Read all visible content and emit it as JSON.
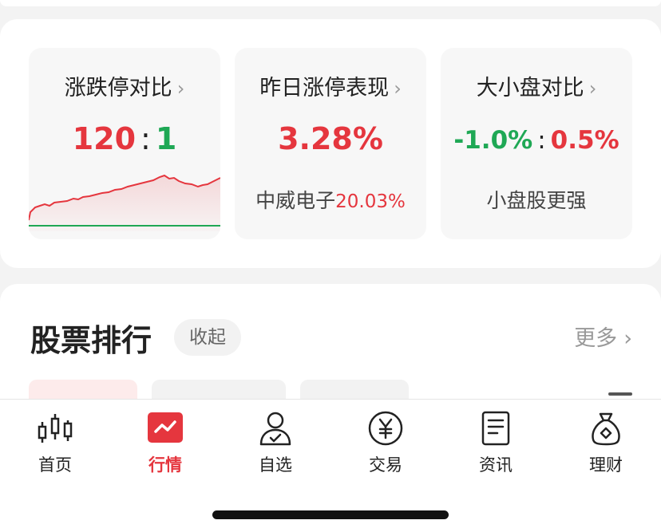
{
  "cards": [
    {
      "title": "涨跌停对比",
      "value_up": "120",
      "separator": ":",
      "value_down": "1"
    },
    {
      "title": "昨日涨停表现",
      "value": "3.28%",
      "sub_name": "中威电子",
      "sub_pct": "20.03%"
    },
    {
      "title": "大小盘对比",
      "value_left": "-1.0%",
      "separator": ":",
      "value_right": "0.5%",
      "sub": "小盘股更强"
    }
  ],
  "ranking": {
    "title": "股票排行",
    "collapse_label": "收起",
    "more_label": "更多"
  },
  "tabbar": [
    {
      "label": "首页",
      "icon": "candlestick-icon"
    },
    {
      "label": "行情",
      "icon": "market-chart-icon",
      "active": true
    },
    {
      "label": "自选",
      "icon": "user-check-icon"
    },
    {
      "label": "交易",
      "icon": "yen-icon"
    },
    {
      "label": "资讯",
      "icon": "document-icon"
    },
    {
      "label": "理财",
      "icon": "money-bag-icon"
    }
  ],
  "colors": {
    "up_red": "#e5363e",
    "down_green": "#1fa855",
    "background": "#f3f3f3"
  }
}
